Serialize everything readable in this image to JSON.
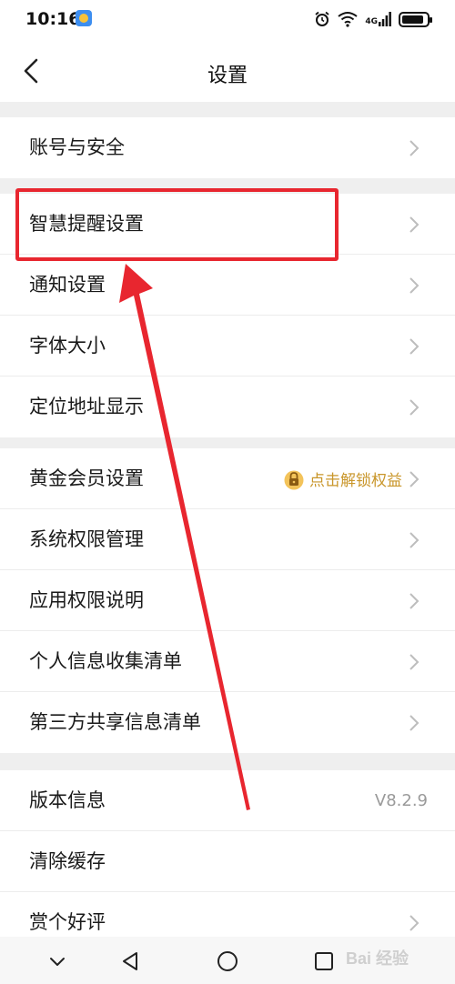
{
  "status_bar": {
    "time": "10:16",
    "network": "4G"
  },
  "header": {
    "title": "设置"
  },
  "groups": [
    {
      "items": [
        {
          "label": "账号与安全"
        }
      ]
    },
    {
      "items": [
        {
          "label": "智慧提醒设置"
        },
        {
          "label": "通知设置"
        },
        {
          "label": "字体大小"
        },
        {
          "label": "定位地址显示"
        }
      ]
    },
    {
      "items": [
        {
          "label": "黄金会员设置",
          "extra": "点击解锁权益"
        },
        {
          "label": "系统权限管理"
        },
        {
          "label": "应用权限说明"
        },
        {
          "label": "个人信息收集清单"
        },
        {
          "label": "第三方共享信息清单"
        }
      ]
    },
    {
      "items": [
        {
          "label": "版本信息",
          "value": "V8.2.9"
        },
        {
          "label": "清除缓存"
        },
        {
          "label": "赏个好评"
        }
      ]
    }
  ],
  "colors": {
    "highlight": "#e8262f",
    "gold": "#c9962a"
  },
  "watermark": "Bai 经验"
}
